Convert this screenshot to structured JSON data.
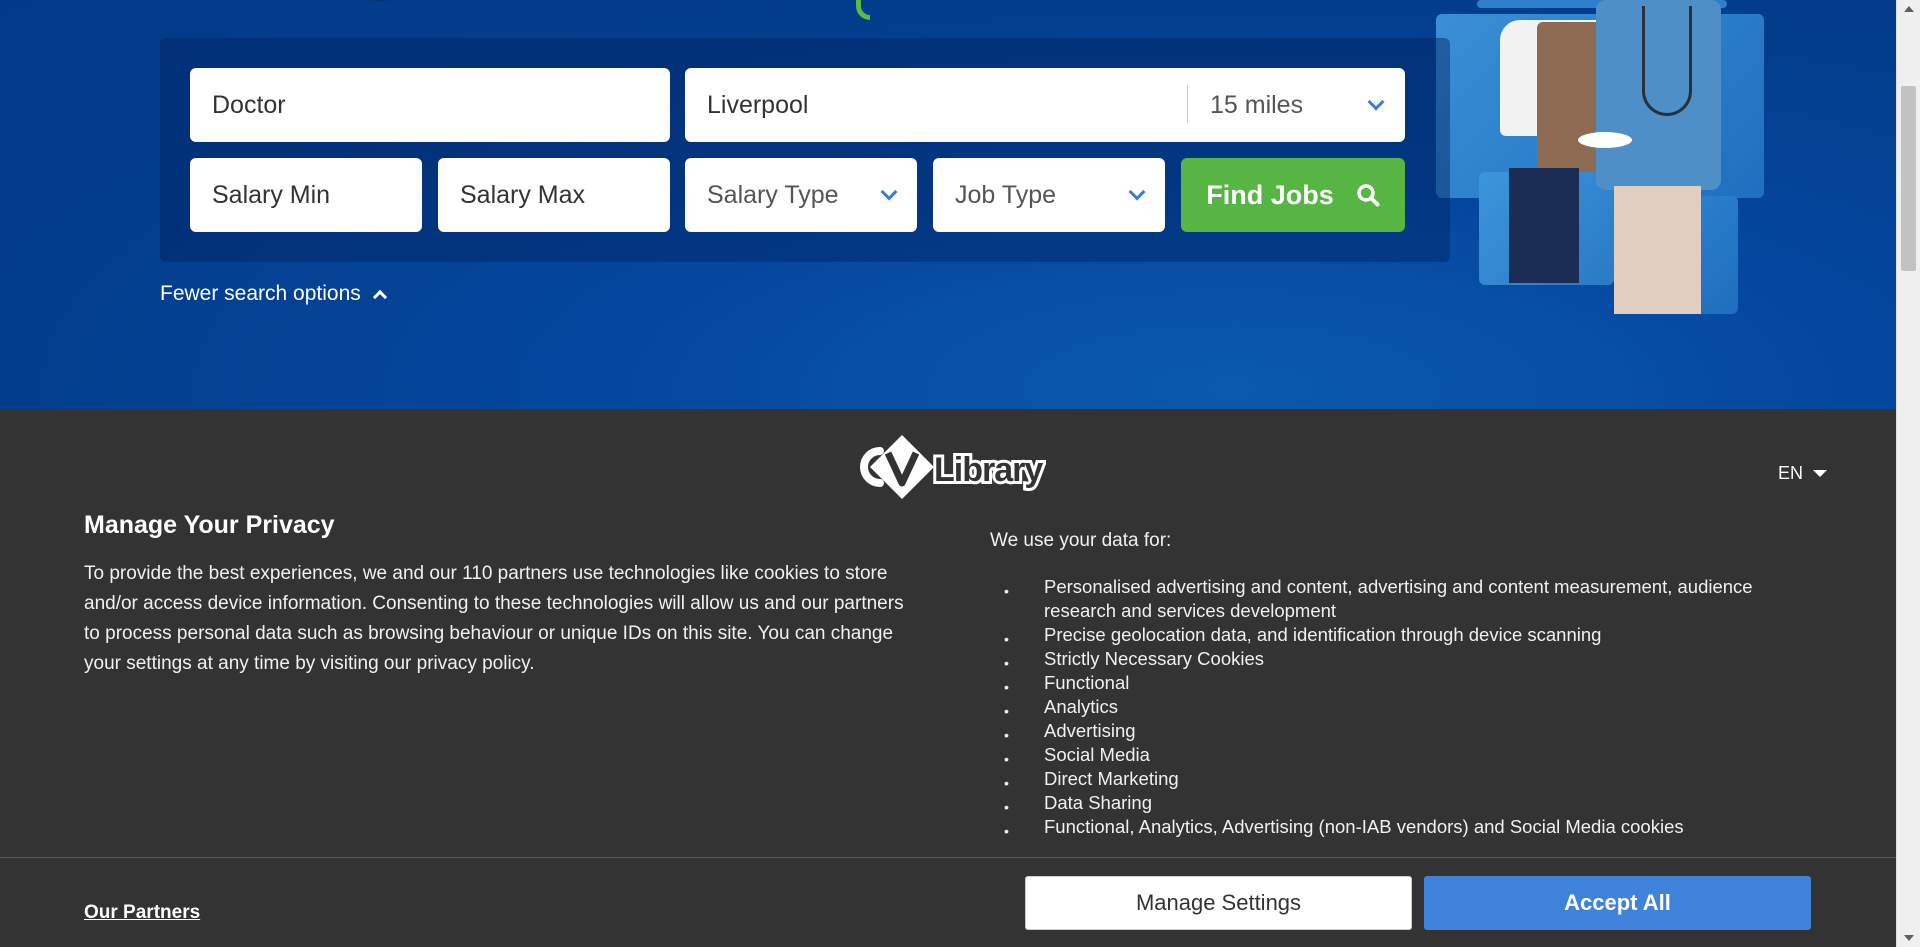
{
  "search": {
    "keywords_value": "Doctor",
    "location_value": "Liverpool",
    "distance_selected": "15 miles",
    "salary_min_placeholder": "Salary Min",
    "salary_max_placeholder": "Salary Max",
    "salary_type_selected": "Salary Type",
    "job_type_selected": "Job Type",
    "find_button_label": "Find Jobs",
    "fewer_options_label": "Fewer search options"
  },
  "privacy": {
    "language": "EN",
    "title": "Manage Your Privacy",
    "body": "To provide the best experiences, we and our 110 partners use technologies like cookies to store and/or access device information. Consenting to these technologies will allow us and our partners to process personal data such as browsing behaviour or unique IDs on this site. You can change your settings at any time by visiting our privacy policy.",
    "uses_title": "We use your data for:",
    "uses": [
      "Personalised advertising and content, advertising and content measurement, audience research and services development",
      "Precise geolocation data, and identification through device scanning",
      "Strictly Necessary Cookies",
      "Functional",
      "Analytics",
      "Advertising",
      "Social Media",
      "Direct Marketing",
      "Data Sharing",
      "Functional, Analytics, Advertising (non-IAB vendors) and Social Media cookies"
    ],
    "partners_link": "Our Partners",
    "manage_button": "Manage Settings",
    "accept_button": "Accept All"
  },
  "brand": {
    "logo_text": "CV Library",
    "accent_color": "#3e82d9",
    "find_button_color": "#57b543",
    "hero_color": "#03398a"
  },
  "icons": {
    "find": "search-icon",
    "select": "chevron-down-icon",
    "fewer": "chevron-up-icon",
    "language": "caret-down-icon"
  }
}
